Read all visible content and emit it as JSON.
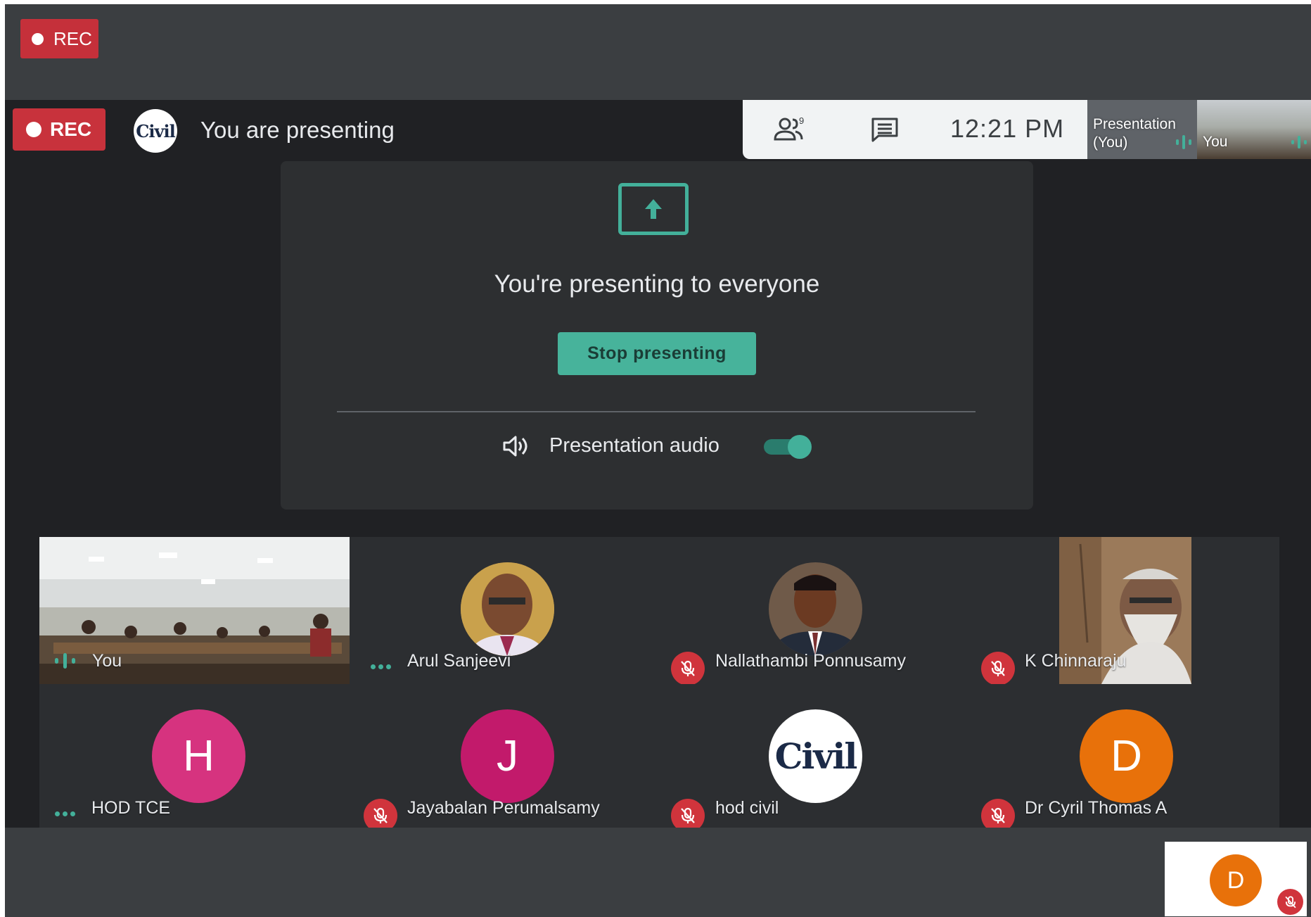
{
  "outer": {
    "rec_label": "REC"
  },
  "header": {
    "rec_label": "REC",
    "logo_text": "Civil",
    "presenting_text": "You are presenting",
    "clock": "12:21 PM",
    "people_count": "9",
    "thumb_presentation_label": "Presentation\n(You)",
    "thumb_presentation_line1": "Presentation",
    "thumb_presentation_line2": "(You)",
    "thumb_you_label": "You"
  },
  "card": {
    "title": "You're presenting to everyone",
    "stop_button": "Stop presenting",
    "audio_label": "Presentation audio",
    "audio_enabled": true
  },
  "participants": [
    {
      "name": "You",
      "status": "speaking",
      "avatar": "video"
    },
    {
      "name": "Arul Sanjeevi",
      "status": "more",
      "avatar": "photo"
    },
    {
      "name": "Nallathambi Ponnusamy",
      "status": "muted",
      "avatar": "photo"
    },
    {
      "name": "K Chinnaraju",
      "status": "muted",
      "avatar": "video"
    },
    {
      "name": "HOD TCE",
      "status": "more",
      "avatar": "letter",
      "initial": "H",
      "color": "#d6337f"
    },
    {
      "name": "Jayabalan Perumalsamy",
      "status": "muted",
      "avatar": "letter",
      "initial": "J",
      "color": "#c21a6b"
    },
    {
      "name": "hod civil",
      "status": "muted",
      "avatar": "logo",
      "logo_text": "Civil"
    },
    {
      "name": "Dr Cyril Thomas A",
      "status": "muted",
      "avatar": "letter",
      "initial": "D",
      "color": "#e8710a"
    }
  ],
  "self_view": {
    "initial": "D",
    "color": "#e8710a",
    "muted": true
  },
  "colors": {
    "accent": "#43b09a",
    "rec": "#c5303a",
    "muted": "#d0343c",
    "background": "#202124"
  }
}
